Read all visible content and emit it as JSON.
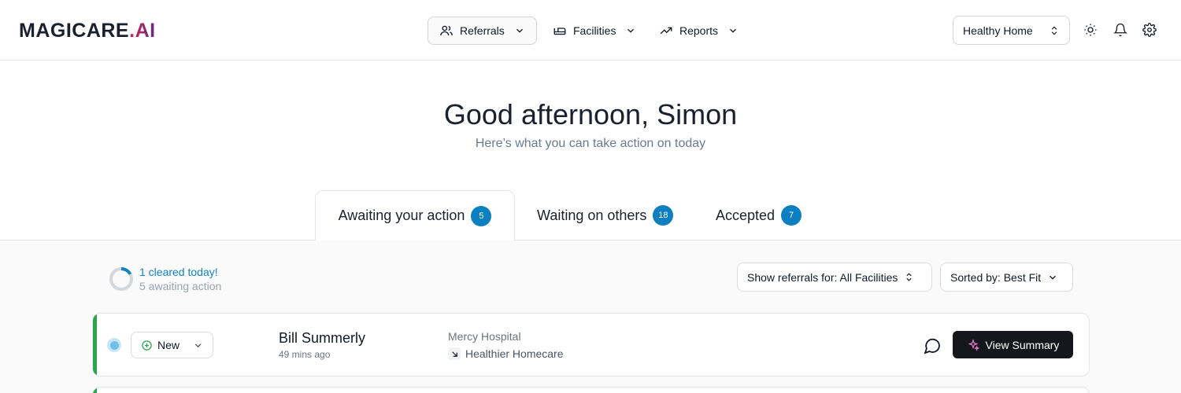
{
  "brand": {
    "logo_main": "MAGICARE",
    "logo_dot": ".",
    "logo_ai": "AI"
  },
  "nav": {
    "referrals": "Referrals",
    "facilities": "Facilities",
    "reports": "Reports"
  },
  "facility_selector": {
    "value": "Healthy Home"
  },
  "greeting": {
    "title": "Good afternoon, Simon",
    "subtitle": "Here’s what you can take action on today"
  },
  "tabs": [
    {
      "label": "Awaiting your action",
      "count": "5"
    },
    {
      "label": "Waiting on others",
      "count": "18"
    },
    {
      "label": "Accepted",
      "count": "7"
    }
  ],
  "progress": {
    "cleared": "1 cleared today!",
    "awaiting": "5 awaiting action",
    "fraction_cleared": 0.17
  },
  "filters": {
    "show_label": "Show referrals for:",
    "show_value": "All Facilities",
    "sort_label": "Sorted by:",
    "sort_value": "Best Fit"
  },
  "referrals": [
    {
      "status": "New",
      "patient": "Bill Summerly",
      "time": "49 mins ago",
      "source": "Mercy Hospital",
      "destination": "Healthier Homecare",
      "action": "View Summary"
    }
  ],
  "colors": {
    "accent_blue": "#0b7fbf",
    "accent_green": "#2aa64f",
    "button_dark": "#15171c"
  }
}
